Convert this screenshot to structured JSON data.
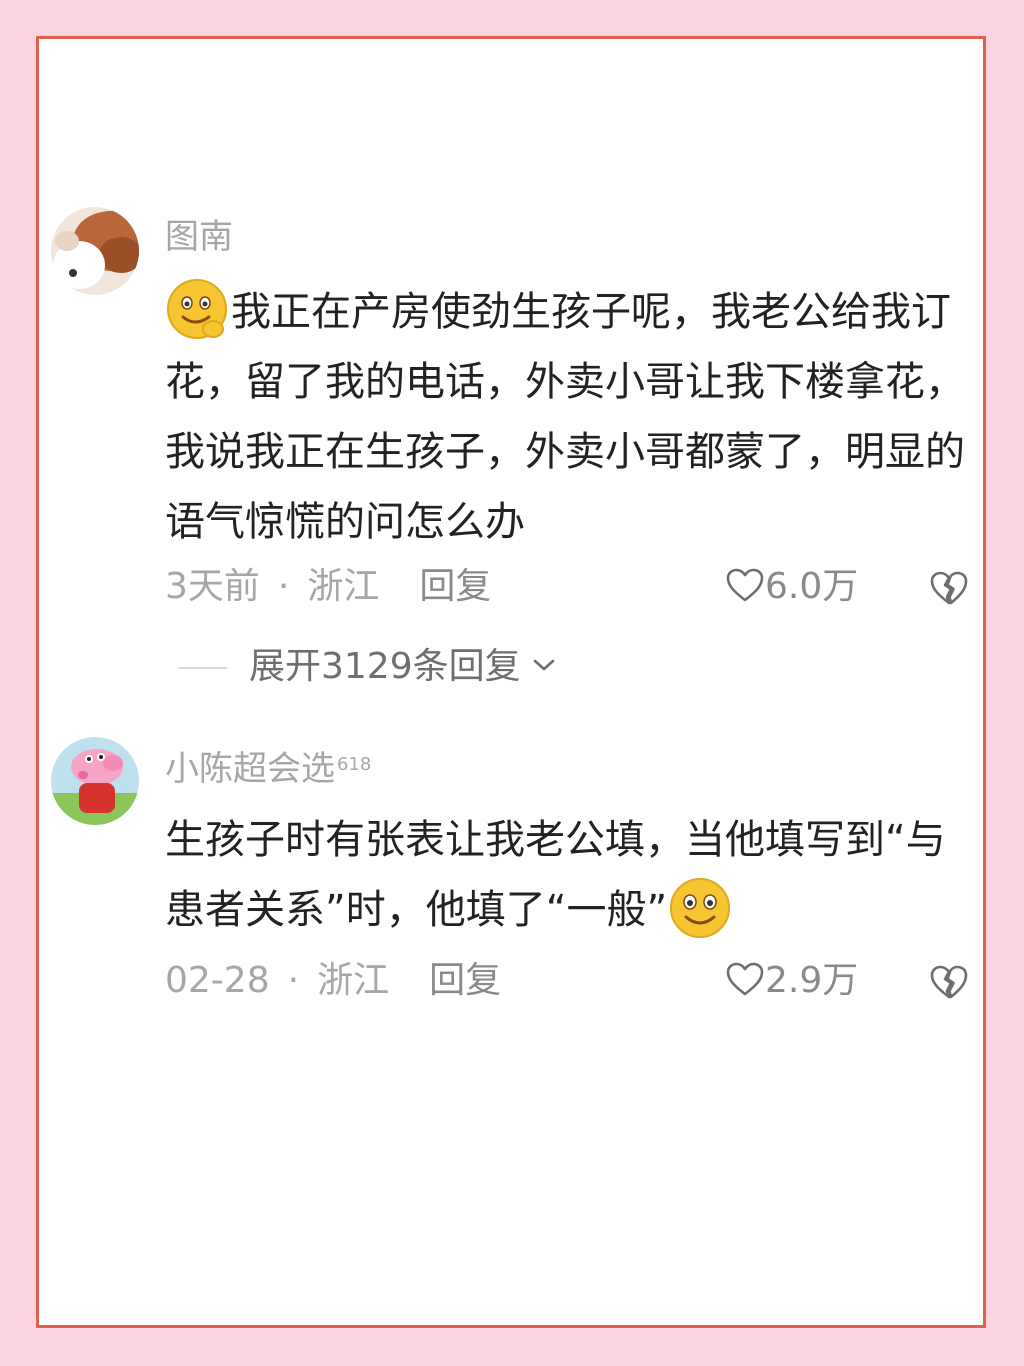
{
  "comments": [
    {
      "username": "图南",
      "content": "我正在产房使劲生孩子呢，我老公给我订花，留了我的电话，外卖小哥让我下楼拿花，我说我正在生孩子，外卖小哥都蒙了，明显的语气惊慌的问怎么办",
      "emoji": "thinking-smile-icon",
      "time": "3天前",
      "separator": "·",
      "location": "浙江",
      "reply_label": "回复",
      "likes": "6.0万",
      "expand_label": "展开3129条回复"
    },
    {
      "username": "小陈超会选",
      "user_badge": "618",
      "content": "生孩子时有张表让我老公填，当他填写到“与患者关系”时，他填了“一般”",
      "emoji": "smile-icon",
      "time": "02-28",
      "separator": "·",
      "location": "浙江",
      "reply_label": "回复",
      "likes": "2.9万"
    }
  ],
  "colors": {
    "background": "#fcd3e1",
    "border": "#e0604a",
    "meta_text": "#a6a6a6",
    "body_text": "#222222"
  }
}
